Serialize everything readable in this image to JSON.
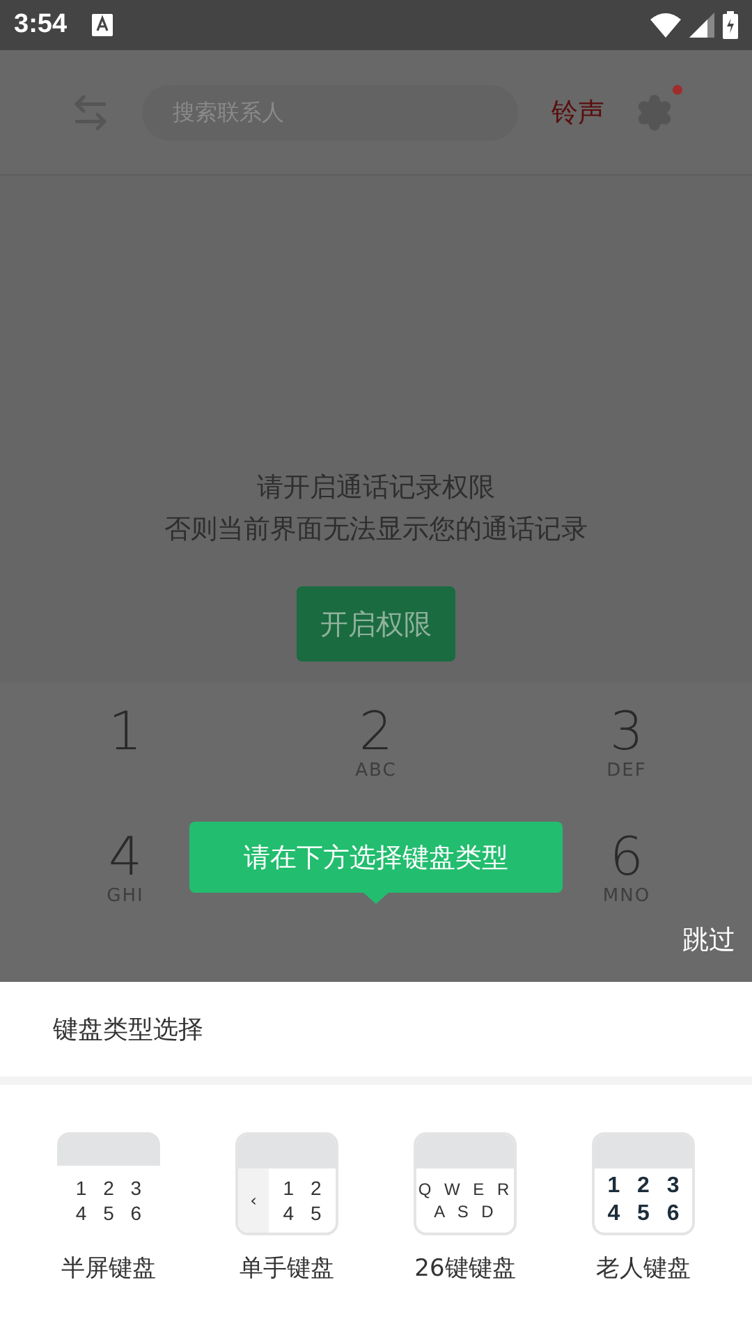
{
  "status_bar": {
    "time": "3:54"
  },
  "header": {
    "search": {
      "placeholder": "搜索联系人"
    },
    "ringtone": "铃声",
    "settings_badge": true
  },
  "permission": {
    "lines": [
      "请开启通话记录权限",
      "否则当前界面无法显示您的通话记录"
    ],
    "button": "开启权限"
  },
  "keypad": {
    "rows": [
      [
        {
          "digit": "1"
        },
        {
          "digit": "2",
          "letters": "ABC"
        },
        {
          "digit": "3",
          "letters": "DEF"
        }
      ],
      [
        {
          "digit": "4",
          "letters": "GHI"
        },
        "",
        {
          "digit": "6",
          "letters": "MNO"
        }
      ]
    ]
  },
  "tooltip": "请在下方选择键盘类型",
  "skip": "跳过",
  "sheet": {
    "title": "键盘类型选择",
    "options": [
      {
        "kind": "half",
        "label": "半屏键盘",
        "rows": [
          "1 2 3",
          "4 5 6"
        ]
      },
      {
        "kind": "one_hand",
        "label": "单手键盘",
        "side": "‹",
        "rows": [
          "1 2",
          "4 5"
        ]
      },
      {
        "kind": "qwerty",
        "label": "26键键盘",
        "rows": [
          "Q W E R",
          "A S D"
        ]
      },
      {
        "kind": "elder",
        "label": "老人键盘",
        "rows": [
          "1 2 3",
          "4 5 6"
        ]
      }
    ]
  }
}
